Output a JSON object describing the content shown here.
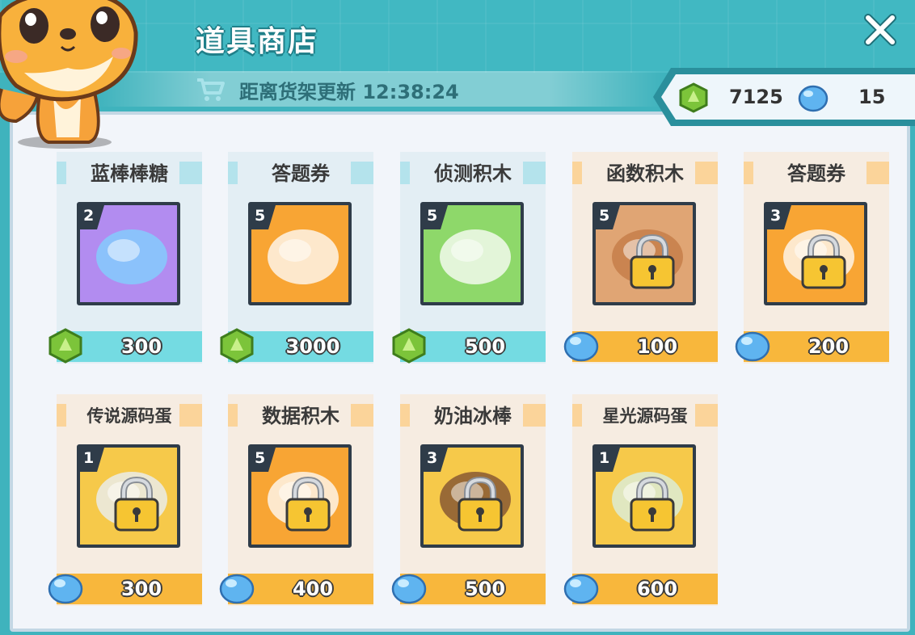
{
  "window": {
    "title": "道具商店"
  },
  "refresh": {
    "text": "距离货架更新 12:38:24"
  },
  "currency": {
    "gems": "7125",
    "orbs": "15"
  },
  "colors": {
    "teal": "#3fb3bd",
    "gem": "#7cc43a",
    "orb": "#5fb4f0",
    "price_blue": "#74dbe2",
    "price_orange": "#f8b73c"
  },
  "items": [
    {
      "name": "蓝棒棒糖",
      "count": "2",
      "price": "300",
      "currency": "gem-icon",
      "locked": false
    },
    {
      "name": "答题券",
      "count": "5",
      "price": "3000",
      "currency": "gem-icon",
      "locked": false
    },
    {
      "name": "侦测积木",
      "count": "5",
      "price": "500",
      "currency": "gem-icon",
      "locked": false
    },
    {
      "name": "函数积木",
      "count": "5",
      "price": "100",
      "currency": "orb-icon",
      "locked": true
    },
    {
      "name": "答题券",
      "count": "3",
      "price": "200",
      "currency": "orb-icon",
      "locked": true
    },
    {
      "name": "传说源码蛋",
      "count": "1",
      "price": "300",
      "currency": "orb-icon",
      "locked": true
    },
    {
      "name": "数据积木",
      "count": "5",
      "price": "400",
      "currency": "orb-icon",
      "locked": true
    },
    {
      "name": "奶油冰棒",
      "count": "3",
      "price": "500",
      "currency": "orb-icon",
      "locked": true
    },
    {
      "name": "星光源码蛋",
      "count": "1",
      "price": "600",
      "currency": "orb-icon",
      "locked": true
    }
  ]
}
